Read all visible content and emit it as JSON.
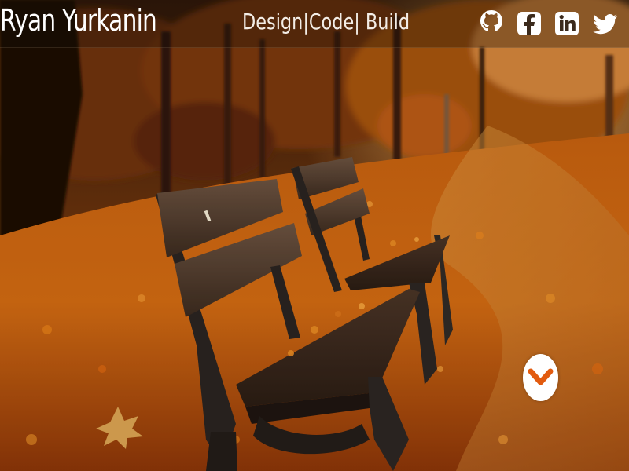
{
  "header": {
    "name": "Ryan Yurkanin",
    "tagline": "Design|Code| Build"
  },
  "social": [
    {
      "icon": "github-icon"
    },
    {
      "icon": "facebook-icon"
    },
    {
      "icon": "linkedin-icon"
    },
    {
      "icon": "twitter-icon"
    }
  ],
  "hero": {
    "scroll_icon": "chevron-down-icon",
    "accent_color": "#e25b0f"
  }
}
